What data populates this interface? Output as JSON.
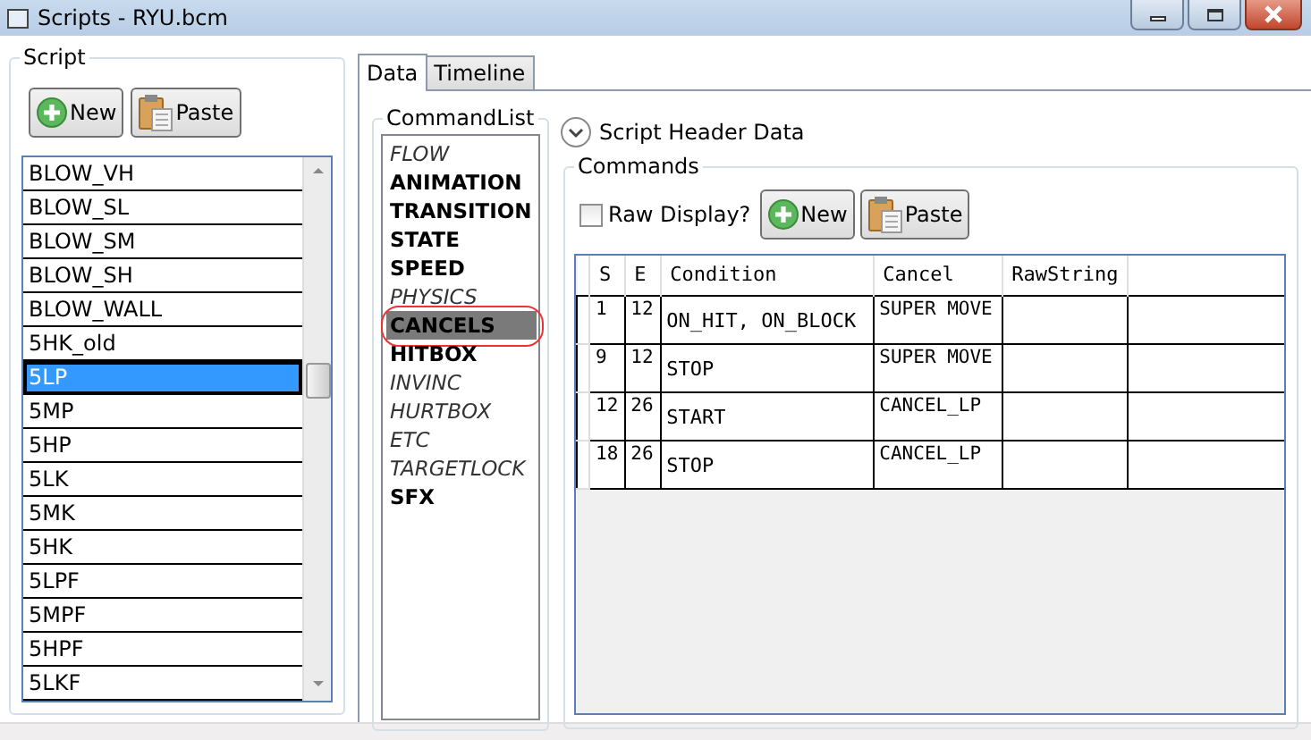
{
  "window": {
    "title": "Scripts - RYU.bcm"
  },
  "script_panel": {
    "legend": "Script",
    "buttons": [
      {
        "kind": "new",
        "label": "New"
      },
      {
        "kind": "paste",
        "label": "Paste"
      }
    ],
    "items": [
      {
        "label": "BLOW_VH",
        "selected": false
      },
      {
        "label": "BLOW_SL",
        "selected": false
      },
      {
        "label": "BLOW_SM",
        "selected": false
      },
      {
        "label": "BLOW_SH",
        "selected": false
      },
      {
        "label": "BLOW_WALL",
        "selected": false
      },
      {
        "label": "5HK_old",
        "selected": false
      },
      {
        "label": "5LP",
        "selected": true
      },
      {
        "label": "5MP",
        "selected": false
      },
      {
        "label": "5HP",
        "selected": false
      },
      {
        "label": "5LK",
        "selected": false
      },
      {
        "label": "5MK",
        "selected": false
      },
      {
        "label": "5HK",
        "selected": false
      },
      {
        "label": "5LPF",
        "selected": false
      },
      {
        "label": "5MPF",
        "selected": false
      },
      {
        "label": "5HPF",
        "selected": false
      },
      {
        "label": "5LKF",
        "selected": false
      }
    ]
  },
  "tabs": [
    {
      "label": "Data",
      "selected": true
    },
    {
      "label": "Timeline",
      "selected": false
    }
  ],
  "command_list": {
    "legend": "CommandList",
    "items": [
      {
        "label": "FLOW",
        "kind": "italic",
        "selected": false
      },
      {
        "label": "ANIMATION",
        "kind": "bold",
        "selected": false
      },
      {
        "label": "TRANSITION",
        "kind": "bold",
        "selected": false
      },
      {
        "label": "STATE",
        "kind": "bold",
        "selected": false
      },
      {
        "label": "SPEED",
        "kind": "bold",
        "selected": false
      },
      {
        "label": "PHYSICS",
        "kind": "italic",
        "selected": false
      },
      {
        "label": "CANCELS",
        "kind": "bold",
        "selected": true
      },
      {
        "label": "HITBOX",
        "kind": "bold",
        "selected": false
      },
      {
        "label": "INVINC",
        "kind": "italic",
        "selected": false
      },
      {
        "label": "HURTBOX",
        "kind": "italic",
        "selected": false
      },
      {
        "label": "ETC",
        "kind": "italic",
        "selected": false
      },
      {
        "label": "TARGETLOCK",
        "kind": "italic",
        "selected": false
      },
      {
        "label": "SFX",
        "kind": "bold",
        "selected": false
      }
    ]
  },
  "header_expander": {
    "label": "Script Header Data",
    "expanded": false
  },
  "commands": {
    "legend": "Commands",
    "raw_display": {
      "label": "Raw Display?",
      "checked": false
    },
    "buttons": [
      {
        "kind": "new",
        "label": "New"
      },
      {
        "kind": "paste",
        "label": "Paste"
      }
    ],
    "table": {
      "columns": [
        "S",
        "E",
        "Condition",
        "Cancel",
        "RawString"
      ],
      "rows": [
        [
          "1",
          "12",
          "ON_HIT, ON_BLOCK",
          "SUPER MOVE",
          ""
        ],
        [
          "9",
          "12",
          "STOP",
          "SUPER MOVE",
          ""
        ],
        [
          "12",
          "26",
          "START",
          "CANCEL_LP",
          ""
        ],
        [
          "18",
          "26",
          "STOP",
          "CANCEL_LP",
          ""
        ]
      ]
    }
  }
}
